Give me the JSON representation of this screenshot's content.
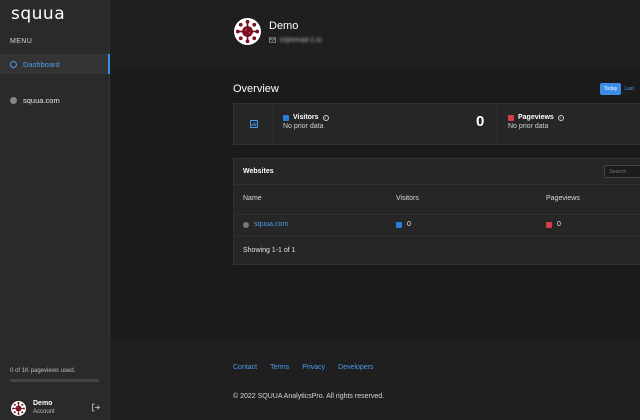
{
  "brand": {
    "logo": "squua"
  },
  "sidebar": {
    "menu_label": "MENU",
    "items": [
      {
        "label": "Dashboard",
        "icon": "dashboard-icon"
      },
      {
        "label": "squua.com",
        "icon": "globe-icon"
      }
    ],
    "usage_text": "0 of 1K pageviews used.",
    "usage_fraction": 0,
    "account": {
      "name": "Demo",
      "subtitle": "Account"
    }
  },
  "profile": {
    "name": "Demo",
    "email": "tr@email-1.io"
  },
  "overview": {
    "title": "Overview",
    "range_today": "Today",
    "range_last": "Last",
    "visitors": {
      "label": "Visitors",
      "sub": "No prior data",
      "value": "0",
      "color": "#2b7ddc"
    },
    "pageviews": {
      "label": "Pageviews",
      "sub": "No prior data",
      "color": "#d93b48"
    }
  },
  "websites": {
    "title": "Websites",
    "search_placeholder": "Search",
    "columns": [
      "Name",
      "Visitors",
      "Pageviews"
    ],
    "rows": [
      {
        "name": "squua.com",
        "visitors": "0",
        "pageviews": "0"
      }
    ],
    "showing": "Showing 1-1 of 1"
  },
  "footer": {
    "links": [
      "Contact",
      "Terms",
      "Privacy",
      "Developers"
    ],
    "copyright": "© 2022 SQUUA AnalyticsPro. All rights reserved."
  },
  "colors": {
    "accent": "#3b8de8",
    "visitors": "#2b7ddc",
    "pageviews": "#d93b48",
    "background": "#1f1f1f",
    "sidebar": "#2a2a2a"
  }
}
